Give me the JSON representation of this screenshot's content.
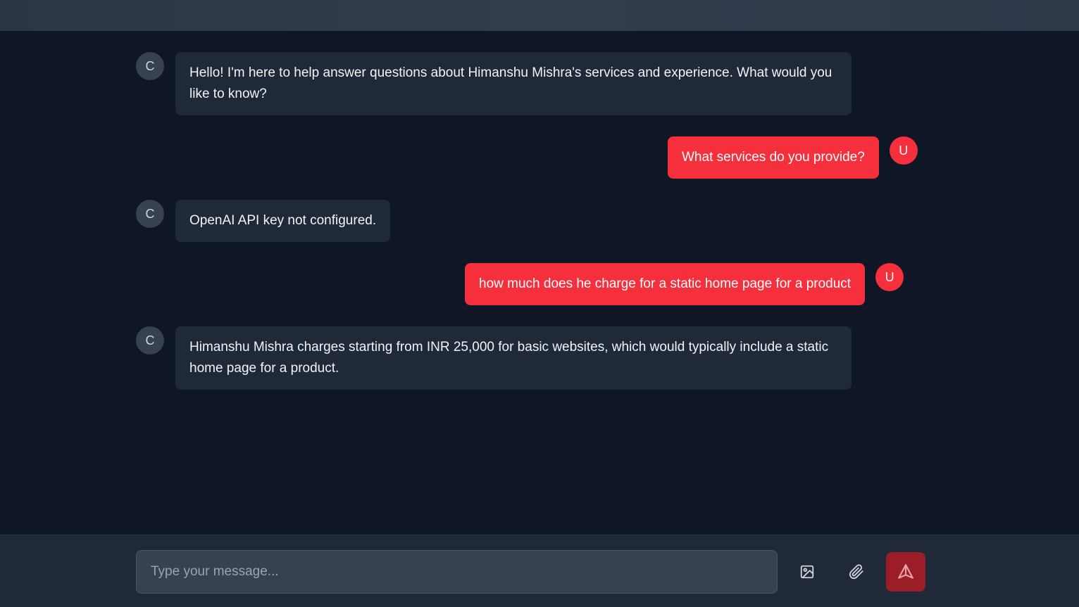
{
  "composer": {
    "placeholder": "Type your message...",
    "image_icon": "image-icon",
    "attach_icon": "paperclip-icon",
    "send_icon": "send-icon"
  },
  "messages": [
    {
      "role": "bot",
      "avatar": "C",
      "text": "Hello! I'm here to help answer questions about Himanshu Mishra's services and experience. What would you like to know?"
    },
    {
      "role": "user",
      "avatar": "U",
      "text": "What services do you provide?"
    },
    {
      "role": "bot",
      "avatar": "C",
      "text": "OpenAI API key not configured."
    },
    {
      "role": "user",
      "avatar": "U",
      "text": "how much does he charge for a static home page for a product"
    },
    {
      "role": "bot",
      "avatar": "C",
      "text": "Himanshu Mishra charges starting from INR 25,000 for basic websites, which would typically include a static home page for a product."
    }
  ],
  "colors": {
    "background": "#0f1727",
    "bot_bubble": "#1f2937",
    "user_bubble": "#f52f3b",
    "send_button": "#9b1d28"
  }
}
